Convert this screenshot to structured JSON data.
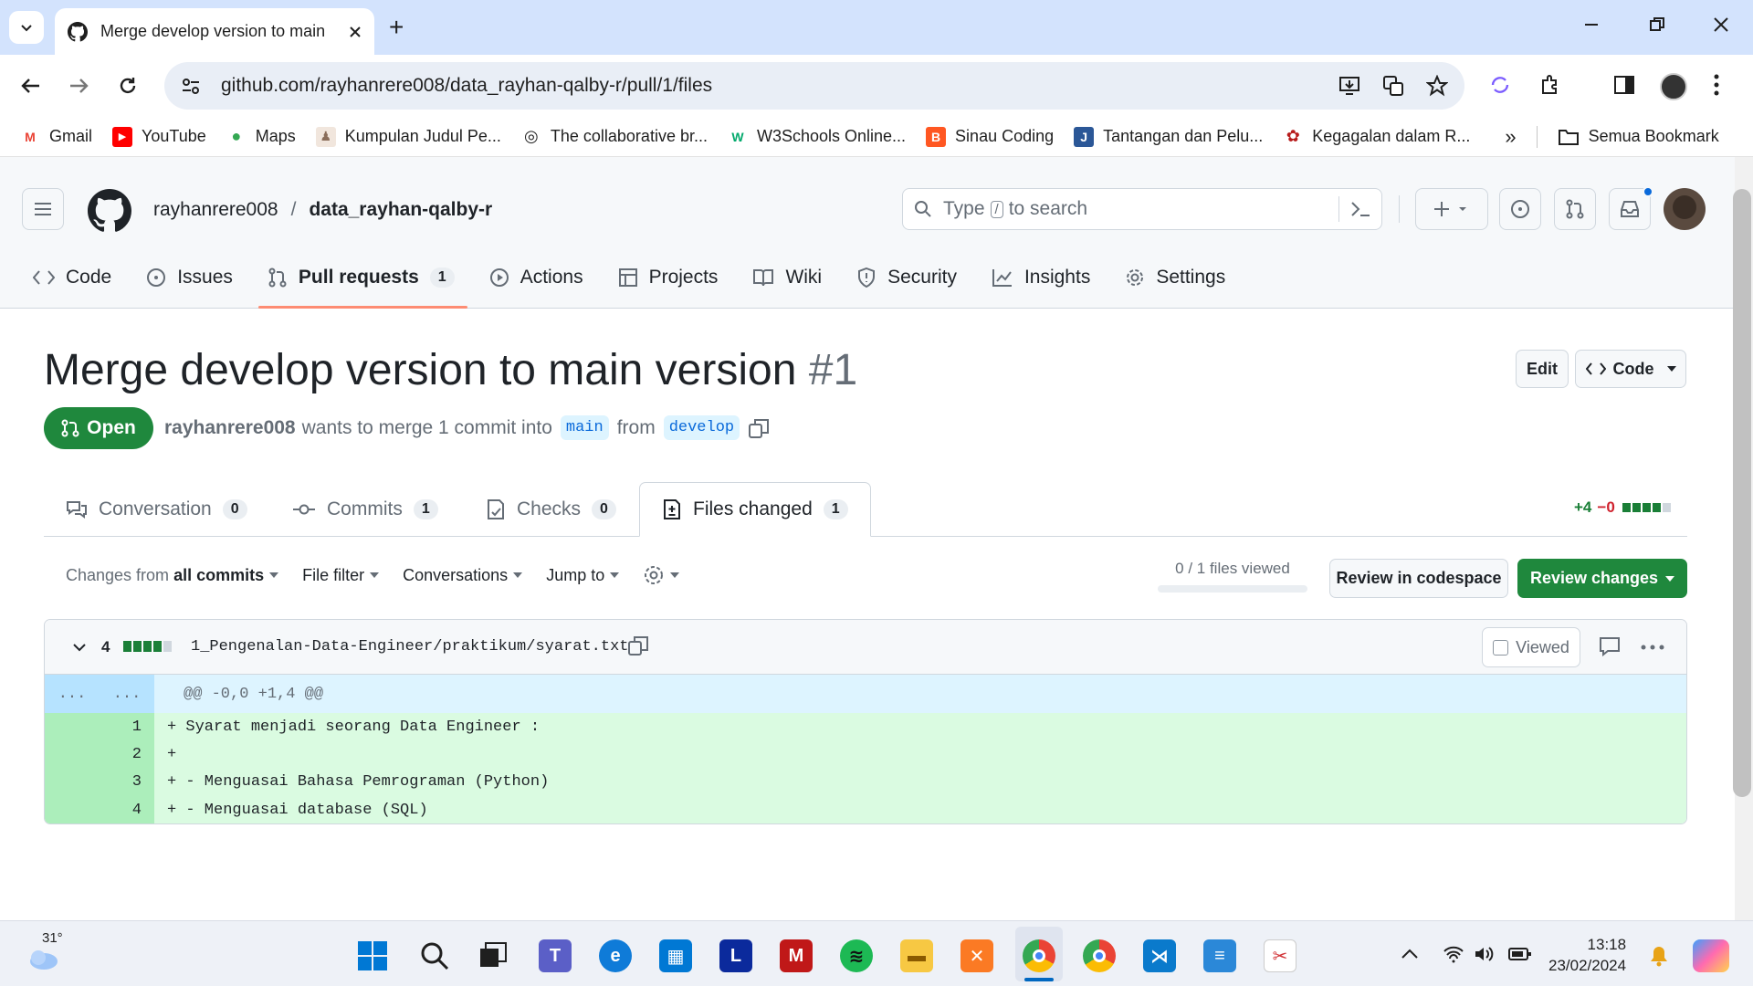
{
  "browser": {
    "tab_title": "Merge develop version to main",
    "new_tab_symbol": "+",
    "url": "github.com/rayhanrere008/data_rayhan-qalby-r/pull/1/files"
  },
  "bookmarks": [
    {
      "label": "Gmail",
      "icon": "gmail-icon",
      "color": "#ea4335",
      "glyph": "M"
    },
    {
      "label": "YouTube",
      "icon": "youtube-icon",
      "color": "#ff0000",
      "glyph": "▶"
    },
    {
      "label": "Maps",
      "icon": "maps-icon",
      "color": "#34a853",
      "glyph": "●"
    },
    {
      "label": "Kumpulan Judul Pe...",
      "icon": "profile-icon",
      "color": "#8a6d5a",
      "glyph": "♟"
    },
    {
      "label": "The collaborative br...",
      "icon": "excalidraw-icon",
      "color": "#1f1f1f",
      "glyph": "◎"
    },
    {
      "label": "W3Schools Online...",
      "icon": "w3schools-icon",
      "color": "#04aa6d",
      "glyph": "W"
    },
    {
      "label": "Sinau Coding",
      "icon": "blogger-icon",
      "color": "#ff5722",
      "glyph": "B"
    },
    {
      "label": "Tantangan dan Pelu...",
      "icon": "doc-icon",
      "color": "#2b5797",
      "glyph": "J"
    },
    {
      "label": "Kegagalan dalam R...",
      "icon": "ugm-icon",
      "color": "#b71c1c",
      "glyph": "✿"
    }
  ],
  "bookmarks_more": "»",
  "all_bookmarks": "Semua Bookmark",
  "repo": {
    "owner": "rayhanrere008",
    "separator": "/",
    "name": "data_rayhan-qalby-r"
  },
  "search": {
    "prefix": "Type",
    "key": "/",
    "suffix": "to search"
  },
  "repo_tabs": [
    {
      "label": "Code",
      "icon": "code-icon",
      "count": null
    },
    {
      "label": "Issues",
      "icon": "issue-icon",
      "count": null
    },
    {
      "label": "Pull requests",
      "icon": "pull-request-icon",
      "count": "1",
      "selected": true
    },
    {
      "label": "Actions",
      "icon": "play-icon",
      "count": null
    },
    {
      "label": "Projects",
      "icon": "table-icon",
      "count": null
    },
    {
      "label": "Wiki",
      "icon": "book-icon",
      "count": null
    },
    {
      "label": "Security",
      "icon": "shield-icon",
      "count": null
    },
    {
      "label": "Insights",
      "icon": "graph-icon",
      "count": null
    },
    {
      "label": "Settings",
      "icon": "gear-icon",
      "count": null
    }
  ],
  "pr": {
    "title": "Merge develop version to main version",
    "number": "#1",
    "status": "Open",
    "author": "rayhanrere008",
    "summary": "wants to merge 1 commit into",
    "base": "main",
    "from": "from",
    "head": "develop",
    "edit_label": "Edit",
    "code_label": "Code"
  },
  "pr_tabs": [
    {
      "label": "Conversation",
      "count": "0"
    },
    {
      "label": "Commits",
      "count": "1"
    },
    {
      "label": "Checks",
      "count": "0"
    },
    {
      "label": "Files changed",
      "count": "1",
      "selected": true
    }
  ],
  "diffstat": {
    "additions": "+4",
    "deletions": "−0",
    "add_color": "#1a7f37",
    "del_color": "#cf222e"
  },
  "toolbar": {
    "changes_from": "Changes from",
    "changes_value": "all commits",
    "file_filter": "File filter",
    "conversations": "Conversations",
    "jump_to": "Jump to",
    "files_viewed": "0 / 1 files viewed",
    "files_viewed_fraction": 0,
    "review_codespace": "Review in codespace",
    "review_changes": "Review changes"
  },
  "file": {
    "changes": "4",
    "path": "1_Pengenalan-Data-Engineer/praktikum/syarat.txt",
    "viewed_label": "Viewed",
    "hunk_old": "...",
    "hunk_new": "...",
    "hunk_header": "@@ -0,0 +1,4 @@",
    "lines": [
      {
        "new": "1",
        "text": "+ Syarat menjadi seorang Data Engineer :"
      },
      {
        "new": "2",
        "text": "+"
      },
      {
        "new": "3",
        "text": "+ - Menguasai Bahasa Pemrograman (Python)"
      },
      {
        "new": "4",
        "text": "+ - Menguasai database (SQL)"
      }
    ]
  },
  "taskbar": {
    "temperature": "31°",
    "time": "13:18",
    "date": "23/02/2024"
  },
  "colors": {
    "accent_green": "#1f883d",
    "link_blue": "#0969da",
    "add_bg": "#dafbe1",
    "add_num_bg": "#aceebb",
    "hunk_bg": "#ddf4ff",
    "tab_underline": "#fd8c73"
  }
}
